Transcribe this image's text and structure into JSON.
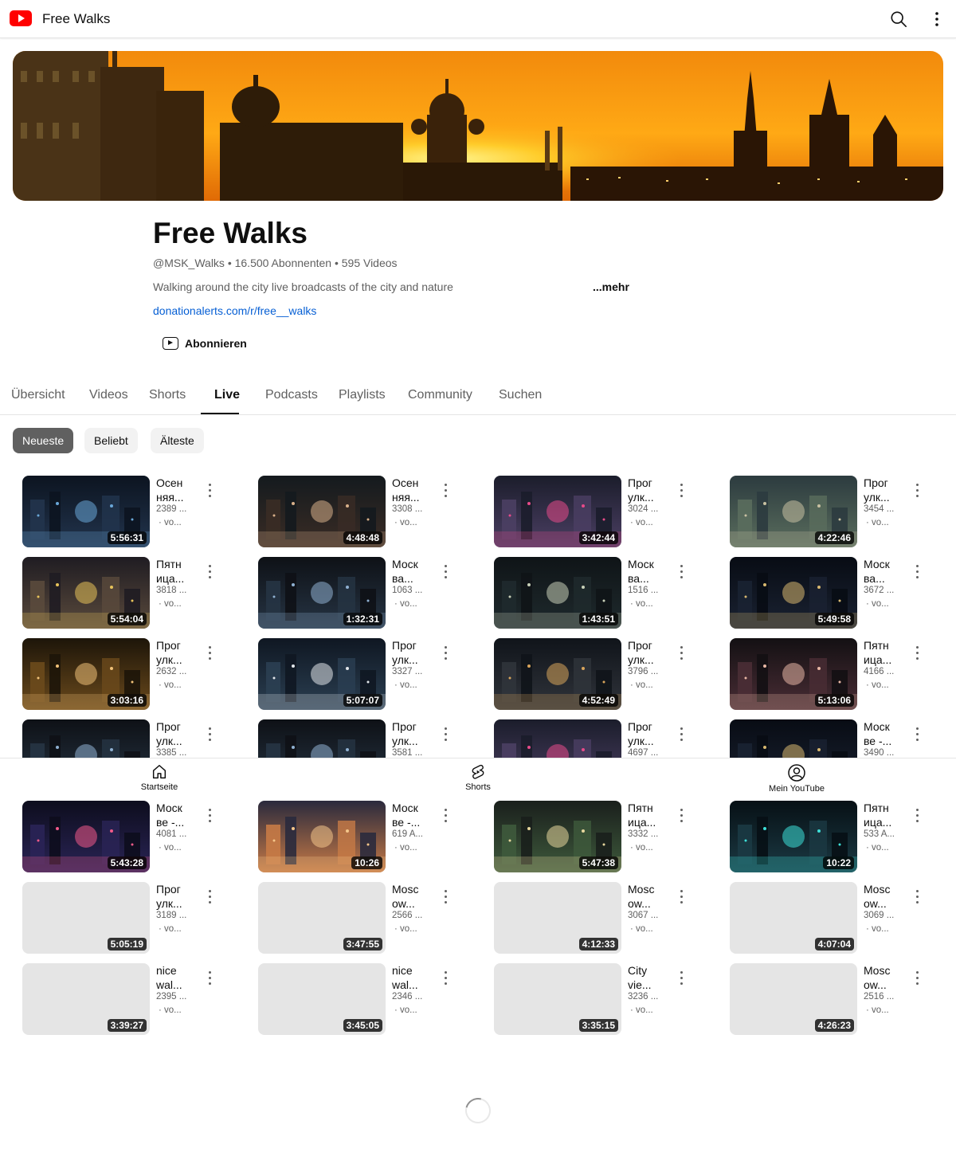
{
  "header": {
    "title": "Free Walks",
    "search_icon": "search-icon",
    "more_icon": "more-vert-icon"
  },
  "channel": {
    "name": "Free Walks",
    "meta": "@MSK_Walks • 16.500 Abonnenten • 595 Videos",
    "description": "Walking around the city live broadcasts of the city and nature",
    "more_label": "...mehr",
    "link": "donationalerts.com/r/free__walks",
    "subscribe_label": "Abonnieren"
  },
  "tabs": [
    "Übersicht",
    "Videos",
    "Shorts",
    "Live",
    "Podcasts",
    "Playlists",
    "Community",
    "Suchen"
  ],
  "active_tab": "Live",
  "chips": [
    "Neueste",
    "Beliebt",
    "Älteste"
  ],
  "active_chip": "Neueste",
  "videos": [
    {
      "title": "Осен\nняя...",
      "views": "2389 ...",
      "age": "· vo...",
      "duration": "5:56:31",
      "theme": "city-night"
    },
    {
      "title": "Осен\nняя...",
      "views": "3308 ...",
      "age": "· vo...",
      "duration": "4:48:48",
      "theme": "portrait-night"
    },
    {
      "title": "Прог\nулк...",
      "views": "3024 ...",
      "age": "· vo...",
      "duration": "3:42:44",
      "theme": "mall-lights"
    },
    {
      "title": "Прог\nулк...",
      "views": "3454 ...",
      "age": "· vo...",
      "duration": "4:22:46",
      "theme": "park-dusk"
    },
    {
      "title": "Пятн\nица...",
      "views": "3818 ...",
      "age": "· vo...",
      "duration": "5:54:04",
      "theme": "crosswalk"
    },
    {
      "title": "Моск\nва...",
      "views": "1063 ...",
      "age": "· vo...",
      "duration": "1:32:31",
      "theme": "street-night"
    },
    {
      "title": "Моск\nва...",
      "views": "1516 ...",
      "age": "· vo...",
      "duration": "1:43:51",
      "theme": "river-night"
    },
    {
      "title": "Моск\nва...",
      "views": "3672 ...",
      "age": "· vo...",
      "duration": "5:49:58",
      "theme": "skyline-night"
    },
    {
      "title": "Прог\nулк...",
      "views": "2632 ...",
      "age": "· vo...",
      "duration": "3:03:16",
      "theme": "arch-warm"
    },
    {
      "title": "Прог\nулк...",
      "views": "3327 ...",
      "age": "· vo...",
      "duration": "5:07:07",
      "theme": "bike-night"
    },
    {
      "title": "Прог\nулк...",
      "views": "3796 ...",
      "age": "· vo...",
      "duration": "4:52:49",
      "theme": "gate-night"
    },
    {
      "title": "Пятн\nица...",
      "views": "4166 ...",
      "age": "· vo...",
      "duration": "5:13:06",
      "theme": "crowd-night"
    },
    {
      "title": "Прог\nулк...",
      "views": "3385 ...",
      "age": "· vo...",
      "duration": "",
      "theme": "street-night"
    },
    {
      "title": "Прог\nулк...",
      "views": "3581 ...",
      "age": "· vo...",
      "duration": "",
      "theme": "street-night"
    },
    {
      "title": "Прог\nулк...",
      "views": "4697 ...",
      "age": "· vo...",
      "duration": "",
      "theme": "mall-lights"
    },
    {
      "title": "Моск\nве -...",
      "views": "3490 ...",
      "age": "· vo...",
      "duration": "",
      "theme": "skyline-night"
    },
    {
      "title": "Моск\nве -...",
      "views": "4081 ...",
      "age": "· vo...",
      "duration": "5:43:28",
      "theme": "street-neon"
    },
    {
      "title": "Моск\nве -...",
      "views": "619 A...",
      "age": "· vo...",
      "duration": "10:26",
      "theme": "skyline-sunset"
    },
    {
      "title": "Пятн\nица...",
      "views": "3332 ...",
      "age": "· vo...",
      "duration": "5:47:38",
      "theme": "bridge-people"
    },
    {
      "title": "Пятн\nица...",
      "views": "533 A...",
      "age": "· vo...",
      "duration": "10:22",
      "theme": "fountain-night"
    },
    {
      "title": "Прог\nулк...",
      "views": "3189 ...",
      "age": "· vo...",
      "duration": "5:05:19",
      "theme": "blank"
    },
    {
      "title": "Mosc\now...",
      "views": "2566 ...",
      "age": "· vo...",
      "duration": "3:47:55",
      "theme": "blank"
    },
    {
      "title": "Mosc\now...",
      "views": "3067 ...",
      "age": "· vo...",
      "duration": "4:12:33",
      "theme": "blank"
    },
    {
      "title": "Mosc\now...",
      "views": "3069 ...",
      "age": "· vo...",
      "duration": "4:07:04",
      "theme": "blank"
    },
    {
      "title": "nice\nwal...",
      "views": "2395 ...",
      "age": "· vo...",
      "duration": "3:39:27",
      "theme": "blank"
    },
    {
      "title": "nice\nwal...",
      "views": "2346 ...",
      "age": "· vo...",
      "duration": "3:45:05",
      "theme": "blank"
    },
    {
      "title": "City\nvie...",
      "views": "3236 ...",
      "age": "· vo...",
      "duration": "3:35:15",
      "theme": "blank"
    },
    {
      "title": "Mosc\now...",
      "views": "2516 ...",
      "age": "· vo...",
      "duration": "4:26:23",
      "theme": "blank"
    }
  ],
  "bottom_nav": [
    {
      "label": "Startseite",
      "icon": "home-icon"
    },
    {
      "label": "Shorts",
      "icon": "shorts-icon"
    },
    {
      "label": "Mein YouTube",
      "icon": "account-icon"
    }
  ]
}
